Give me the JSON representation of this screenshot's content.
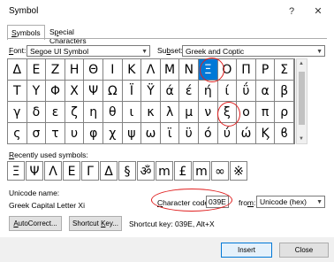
{
  "window": {
    "title": "Symbol",
    "help": "?",
    "close_glyph": "✕"
  },
  "tabs": [
    {
      "label": "Symbols",
      "hotkey_prefix": "",
      "hotkey": "S",
      "rest": "ymbols"
    },
    {
      "label": "Special Characters",
      "hotkey_prefix": "S",
      "hotkey": "p",
      "rest": "ecial Characters"
    }
  ],
  "font": {
    "label_hotkey": "F",
    "label_rest": "ont:",
    "value": "Segoe UI Symbol"
  },
  "subset": {
    "label_prefix": "Su",
    "label_hotkey": "b",
    "label_rest": "set:",
    "value": "Greek and Coptic"
  },
  "grid": {
    "rows": [
      [
        "Δ",
        "Ε",
        "Ζ",
        "Η",
        "Θ",
        "Ι",
        "Κ",
        "Λ",
        "Μ",
        "Ν",
        "Ξ",
        "Ο",
        "Π",
        "Ρ",
        "Σ"
      ],
      [
        "Τ",
        "Υ",
        "Φ",
        "Χ",
        "Ψ",
        "Ω",
        "Ϊ",
        "Ϋ",
        "ά",
        "έ",
        "ή",
        "ί",
        "ΰ",
        "α",
        "β"
      ],
      [
        "γ",
        "δ",
        "ε",
        "ζ",
        "η",
        "θ",
        "ι",
        "κ",
        "λ",
        "μ",
        "ν",
        "ξ",
        "ο",
        "π",
        "ρ"
      ],
      [
        "ς",
        "σ",
        "τ",
        "υ",
        "φ",
        "χ",
        "ψ",
        "ω",
        "ϊ",
        "ϋ",
        "ό",
        "ύ",
        "ώ",
        "Ϗ",
        "ϐ"
      ]
    ],
    "selected": "Ξ"
  },
  "recent": {
    "label_hotkey": "R",
    "label_rest": "ecently used symbols:",
    "symbols": [
      "Ξ",
      "Ψ",
      "Λ",
      "Ε",
      "Γ",
      "Δ",
      "§",
      "ॐ",
      "m",
      "£",
      "m",
      "∞",
      "※"
    ]
  },
  "unicode_name": {
    "label": "Unicode name:",
    "value": "Greek Capital Letter Xi"
  },
  "char_code": {
    "label_prefix": "",
    "label_hotkey": "C",
    "label_rest": "haracter code:",
    "value": "039E"
  },
  "from": {
    "label_hotkey": "m",
    "label_prefix": "fro",
    "label_rest": ":",
    "value": "Unicode (hex)"
  },
  "buttons": {
    "autocorrect_hotkey": "A",
    "autocorrect_rest": "utoCorrect...",
    "shortcut_prefix": "Shortcut ",
    "shortcut_hotkey": "K",
    "shortcut_rest": "ey...",
    "insert": "Insert",
    "close": "Close"
  },
  "shortcut_key_text": "Shortcut key: 039E, Alt+X"
}
